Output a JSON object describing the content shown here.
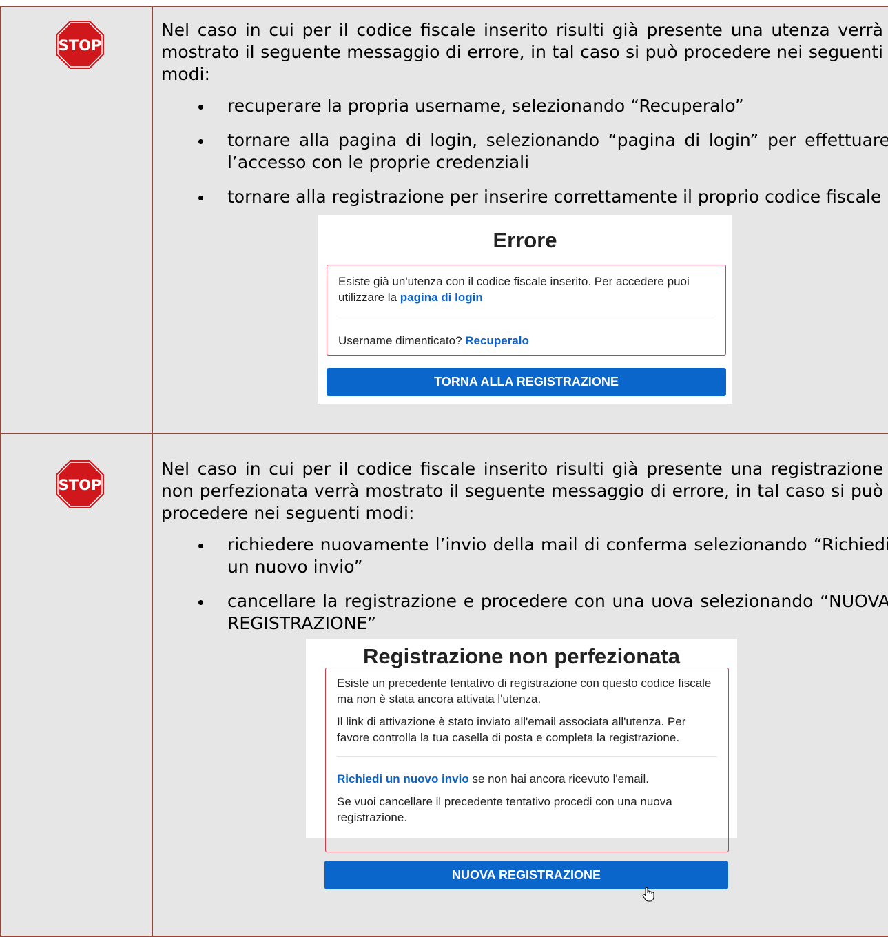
{
  "stop_icon": {
    "label": "STOP",
    "color": "#d0171b"
  },
  "rows": [
    {
      "intro": "Nel caso in cui per il codice fiscale inserito risulti già presente una utenza verrà mostrato il seguente messaggio di errore, in tal caso si può procedere nei seguenti modi:",
      "bullets": [
        "recuperare la propria username, selezionando “Recuperalo”",
        "tornare alla pagina di login, selezionando “pagina di login” per effettuare l’accesso con le proprie credenziali",
        "tornare alla registrazione per inserire correttamente il proprio codice fiscale"
      ],
      "panel": {
        "title": "Errore",
        "msg_prefix": "Esiste già un'utenza con il codice fiscale inserito. Per accedere puoi utilizzare la",
        "login_link": "pagina di login",
        "forgot_prefix": "Username dimenticato?",
        "recover_link": "Recuperalo",
        "button": "TORNA ALLA REGISTRAZIONE"
      }
    },
    {
      "intro": "Nel caso in cui per il codice fiscale inserito risulti già presente una registrazione non perfezionata verrà mostrato il seguente messaggio di errore, in tal caso si può procedere nei seguenti modi:",
      "bullets": [
        "richiedere nuovamente l’invio della mail di conferma selezionando “Richiedi un nuovo invio”",
        "cancellare la registrazione e procedere con una uova selezionando “NUOVA REGISTRAZIONE”"
      ],
      "panel": {
        "title": "Registrazione non perfezionata",
        "msg1": "Esiste un precedente tentativo di registrazione con questo codice fiscale ma non è stata ancora attivata l'utenza.",
        "msg2": "Il link di attivazione è stato inviato all'email associata all'utenza. Per favore controlla la tua casella di posta e completa la registrazione.",
        "resend_link": "Richiedi un nuovo invio",
        "resend_suffix": "se non hai ancora ricevuto l'email.",
        "cancel_text": "Se vuoi cancellare il precedente tentativo procedi con una nuova registrazione.",
        "button": "NUOVA REGISTRAZIONE"
      }
    }
  ],
  "colors": {
    "border": "#8b4a3c",
    "cell_bg": "#e6e6e6",
    "error_border": "#d63a4a",
    "link": "#0b63c9",
    "button": "#0b66cc"
  }
}
